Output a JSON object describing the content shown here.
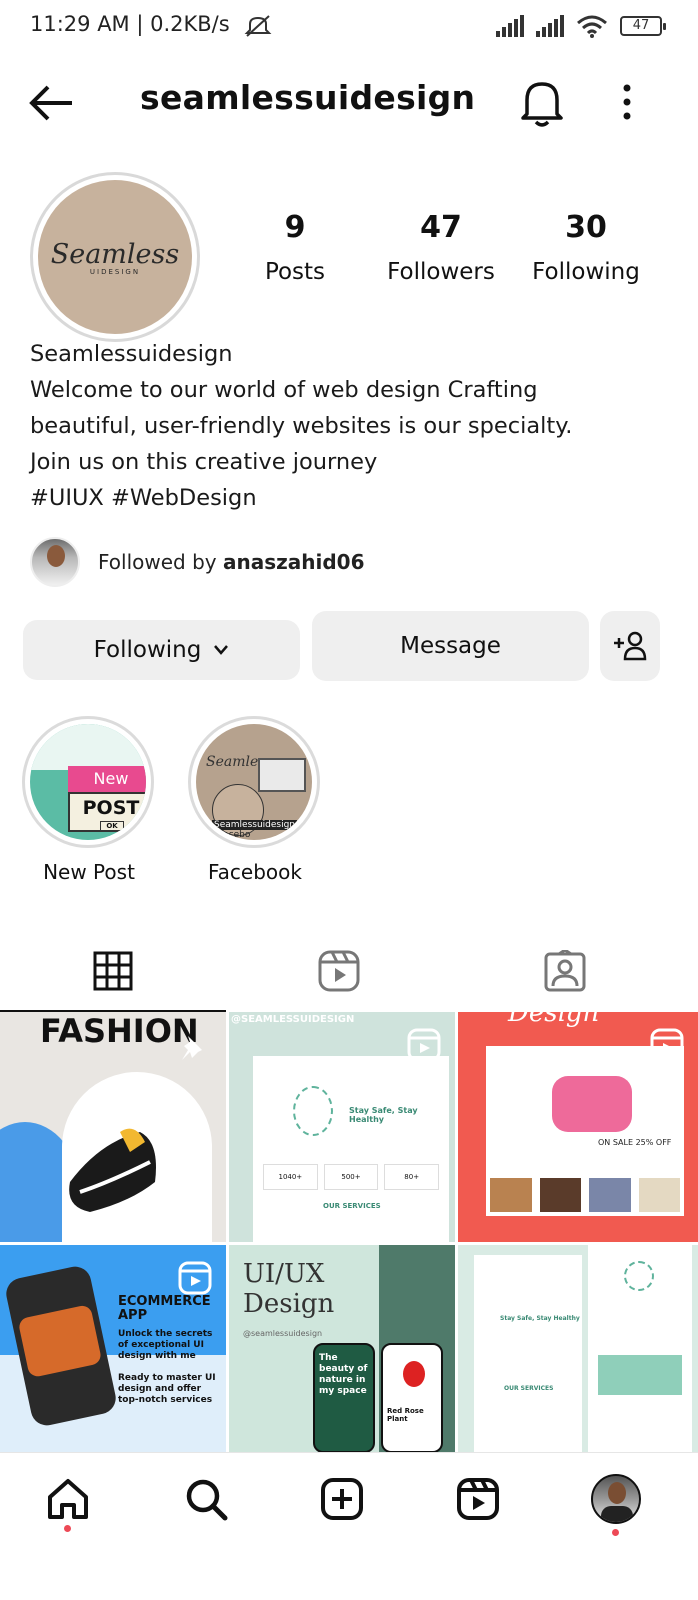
{
  "status_bar": {
    "time": "11:29 AM | 0.2KB/s",
    "battery": "47"
  },
  "header": {
    "username": "seamlessuidesign",
    "back_icon": "arrow-left-icon",
    "bell_icon": "bell-icon",
    "more_icon": "more-vertical-icon"
  },
  "profile": {
    "avatar_logo": "Seamless",
    "avatar_logo_sub": "UIDESIGN",
    "stats": [
      {
        "value": "9",
        "label": "Posts"
      },
      {
        "value": "47",
        "label": "Followers"
      },
      {
        "value": "30",
        "label": "Following"
      }
    ],
    "bio_lines": [
      "Seamlessuidesign",
      "Welcome to our world of web design Crafting",
      "beautiful, user-friendly websites is our specialty.",
      "Join us on this creative journey",
      "#UIUX #WebDesign"
    ],
    "followed_by_prefix": "Followed by ",
    "followed_by_user": "anaszahid06"
  },
  "actions": {
    "following_label": "Following",
    "message_label": "Message",
    "add_user_icon": "add-user-icon"
  },
  "highlights": [
    {
      "label": "New Post",
      "tag": "New",
      "text": "POST",
      "ok": "OK"
    },
    {
      "label": "Facebook",
      "brand": "Seamless",
      "sub": "Seamlessuidesign",
      "foot": "facebo"
    }
  ],
  "tabs": [
    "grid-icon",
    "reels-icon",
    "tagged-icon"
  ],
  "grid_posts": [
    {
      "title": "FASHION"
    },
    {
      "title": "@SEAMLESSUIDESIGN",
      "headline": "Stay Safe, Stay Healthy",
      "stats": [
        "1040+",
        "500+",
        "80+"
      ],
      "section": "OUR SERVICES"
    },
    {
      "title": "Design",
      "promo": "ON SALE 25% OFF"
    },
    {
      "title": "ECOMMERCE APP",
      "text": "Unlock the secrets of exceptional UI design with me",
      "text2": "Ready to master UI design and offer top-notch services"
    },
    {
      "title1": "UI/UX",
      "title2": "Design",
      "handle": "@seamlessuidesign",
      "phone_text": "The beauty of nature in my space",
      "plant": "Red Rose Plant"
    },
    {
      "headline": "Stay Safe, Stay Healthy",
      "section": "OUR SERVICES"
    }
  ],
  "bottom_nav": [
    "home-icon",
    "search-icon",
    "create-icon",
    "reels-icon",
    "profile-avatar"
  ],
  "colors": {
    "accent_red": "#ed4956",
    "button_bg": "#efefef",
    "avatar_bg": "#c7b29d",
    "teal": "#5fb39c"
  }
}
